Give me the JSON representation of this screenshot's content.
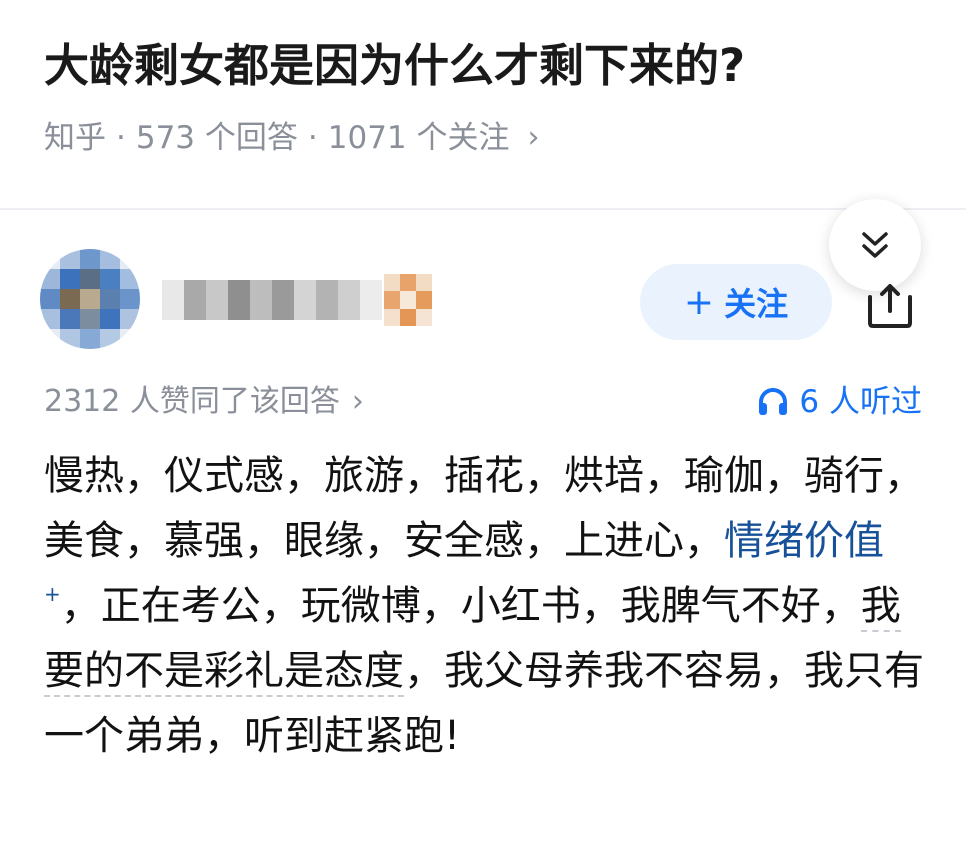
{
  "question": {
    "title": "大龄剩女都是因为什么才剩下来的?",
    "source": "知乎",
    "answers": "573 个回答",
    "followers": "1071 个关注",
    "separator": "·",
    "chevron": "›"
  },
  "author": {
    "name_blurred": true,
    "follow_plus": "+",
    "follow_label": "关注"
  },
  "answer": {
    "votes": "2312 人赞同了该回答",
    "vote_chevron": "›",
    "listened": "6 人听过",
    "text_1": "慢热，仪式感，旅游，插花，烘培，瑜伽，骑行，美食，慕强，眼缘，安全感，上进心，",
    "keyword": "情绪价值",
    "keyword_mark": "+",
    "text_2": "，正在考公，玩微博，小红书，我脾气不好，",
    "underlined": "我要的不是彩礼是态度",
    "text_3": "，我父母养我不容易，我只有一个弟弟，听到赶紧跑!"
  },
  "icons": {
    "collapse": "double-chevron-down-icon",
    "share": "share-icon",
    "headphones": "headphones-icon"
  },
  "colors": {
    "accent": "#1772f6",
    "keyword": "#175199",
    "meta": "#8a8f99",
    "follow_bg": "#eaf2fe"
  }
}
